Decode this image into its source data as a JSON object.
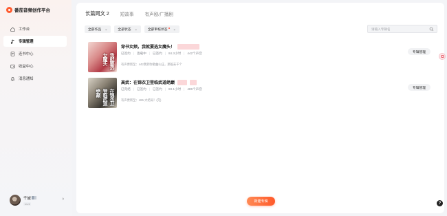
{
  "brand": {
    "logo_text": "番茄音频创作平台"
  },
  "sidebar": {
    "items": [
      {
        "label": "工作台",
        "icon": "home-icon",
        "active": false
      },
      {
        "label": "专辑管理",
        "icon": "music-note-icon",
        "active": true
      },
      {
        "label": "连书中心",
        "icon": "book-icon",
        "active": false
      },
      {
        "label": "收益中心",
        "icon": "wallet-icon",
        "active": false
      },
      {
        "label": "消息通知",
        "icon": "bell-icon",
        "active": false
      }
    ]
  },
  "user": {
    "name": "千城",
    "badge": "Lv.1",
    "chevron": "›"
  },
  "tabs": [
    {
      "label": "长篇网文 2",
      "active": true
    },
    {
      "label": "短故事",
      "active": false
    },
    {
      "label": "有声剧/广播剧",
      "active": false
    }
  ],
  "filters": [
    {
      "label": "全部作品",
      "caret": "⌄"
    },
    {
      "label": "全部状态",
      "caret": "⌄"
    },
    {
      "label": "全部审核状态",
      "caret": "⌄"
    }
  ],
  "search": {
    "placeholder": "请输入专辑名"
  },
  "books": [
    {
      "title": "穿书女频，我就要选女魔头！",
      "cover_text": "我就要选女魔头",
      "meta": [
        "已签约",
        "连载中",
        "已签约",
        "84.3小时",
        "442个声音"
      ],
      "update": "有声更新至：442我到你歌曲山庄，那般去千个",
      "manage_label": "专辑管理"
    },
    {
      "title": "高武：在锦衣卫登临武道绝巅",
      "cover_text": "在锦衣卫登临武道绝巅",
      "meta": [
        "已完结",
        "已签约",
        "已签约",
        "83.1小时",
        "485个声音"
      ],
      "update": "有声更新至：485.大结局！(完)",
      "manage_label": "专辑管理"
    }
  ],
  "create_button": {
    "label": "新建专辑"
  },
  "help": {
    "label": "?"
  },
  "colors": {
    "accent": "#ff5a2a",
    "active_nav_bg": "#ffffff"
  }
}
